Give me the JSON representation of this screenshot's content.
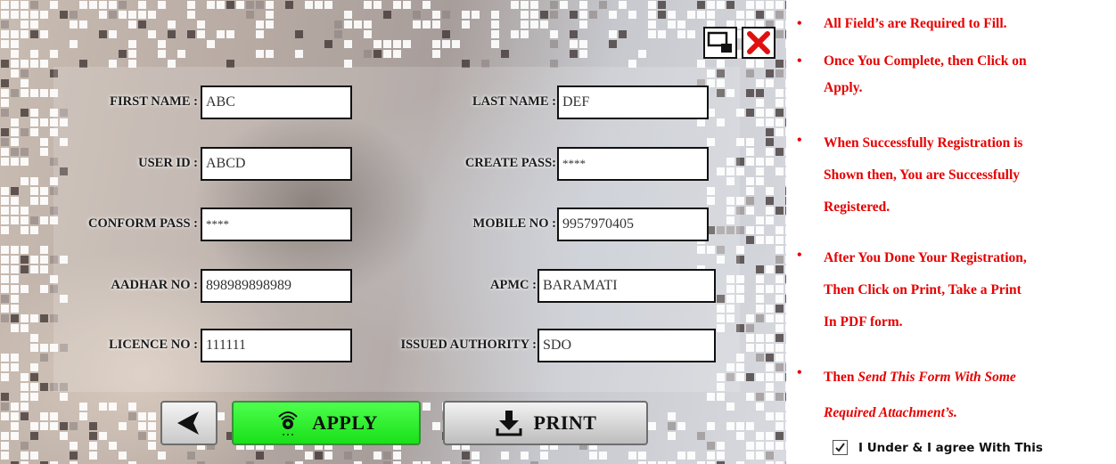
{
  "form": {
    "fields": [
      {
        "id": "first-name",
        "label": "FIRST NAME :",
        "value": "ABC"
      },
      {
        "id": "last-name",
        "label": "LAST NAME :",
        "value": "DEF"
      },
      {
        "id": "user-id",
        "label": "USER ID :",
        "value": "ABCD"
      },
      {
        "id": "create-pass",
        "label": "CREATE PASS:",
        "value": "****"
      },
      {
        "id": "conform-pass",
        "label": "CONFORM PASS :",
        "value": "****"
      },
      {
        "id": "mobile-no",
        "label": "MOBILE NO :",
        "value": "9957970405"
      },
      {
        "id": "aadhar-no",
        "label": "AADHAR NO :",
        "value": "898989898989"
      },
      {
        "id": "apmc",
        "label": "APMC :",
        "value": "BARAMATI"
      },
      {
        "id": "licence-no",
        "label": "LICENCE NO :",
        "value": "111111"
      },
      {
        "id": "issued-authority",
        "label": "ISSUED AUTHORITY :",
        "value": "SDO"
      }
    ],
    "buttons": {
      "apply_label": "APPLY",
      "print_label": "PRINT",
      "back_icon": "left-arrow-icon",
      "apply_icon": "fingerprint-icon",
      "print_icon": "download-icon"
    },
    "window": {
      "minimize_icon": "minimize-icon",
      "close_icon": "close-icon"
    },
    "colors": {
      "apply_green": "#1ee61e",
      "close_red": "#e01010"
    }
  },
  "instructions": {
    "color": "#e60000",
    "items": [
      {
        "lines": [
          "All Field’s are Required to Fill."
        ]
      },
      {
        "lines": [
          "Once You Complete, then Click on",
          "Apply."
        ]
      },
      {
        "lines": [
          "When Successfully Registration is",
          "Shown then, You are Successfully",
          "Registered."
        ]
      },
      {
        "lines": [
          "After You Done Your Registration,",
          "Then Click on Print, Take a Print",
          "In PDF form."
        ]
      },
      {
        "lines": [
          "Then "
        ],
        "italic_lines": [
          "Send This Form With Some",
          "Required Attachment’s."
        ]
      }
    ],
    "agree": {
      "checked": true,
      "label": "I Under & I agree With This"
    }
  }
}
